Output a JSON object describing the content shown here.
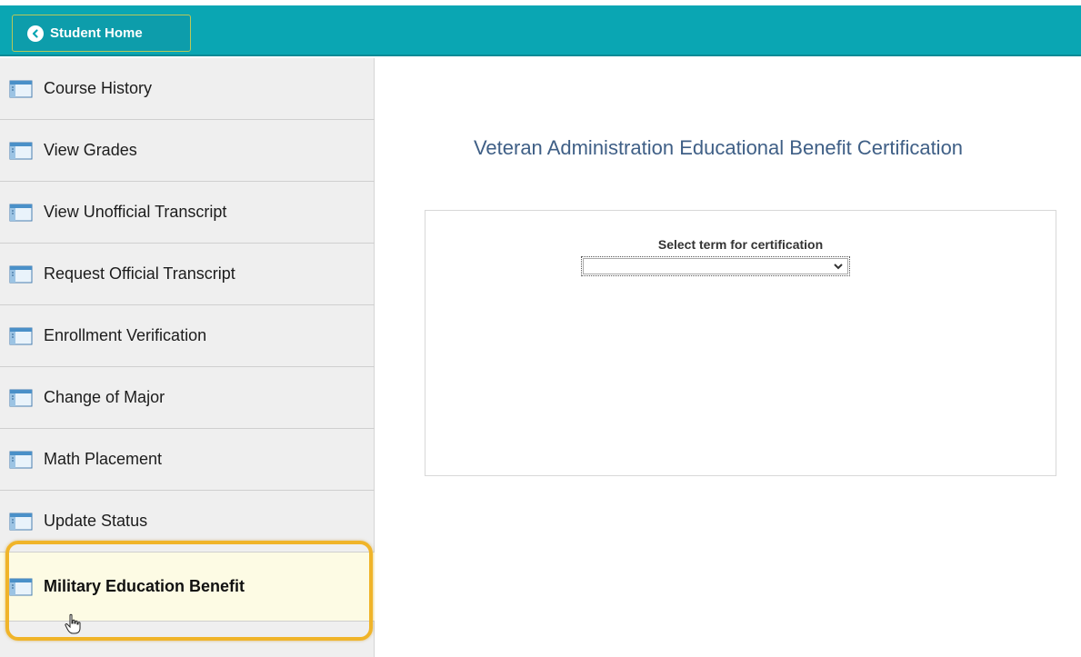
{
  "header": {
    "home_button_label": "Student Home",
    "accent_color": "#0aa6b3"
  },
  "sidebar": {
    "items": [
      {
        "label": "Course History",
        "icon": "page-icon"
      },
      {
        "label": "View Grades",
        "icon": "page-icon"
      },
      {
        "label": "View Unofficial Transcript",
        "icon": "page-icon"
      },
      {
        "label": "Request Official Transcript",
        "icon": "page-icon"
      },
      {
        "label": "Enrollment Verification",
        "icon": "page-icon"
      },
      {
        "label": "Change of Major",
        "icon": "page-icon"
      },
      {
        "label": "Math Placement",
        "icon": "page-icon"
      },
      {
        "label": "Update Status",
        "icon": "page-icon"
      },
      {
        "label": "Military Education Benefit",
        "icon": "page-icon",
        "selected": true
      }
    ],
    "highlight_color": "#f0b429"
  },
  "main": {
    "title": "Veteran Administration Educational Benefit Certification",
    "term_label": "Select term for certification",
    "term_value": ""
  }
}
